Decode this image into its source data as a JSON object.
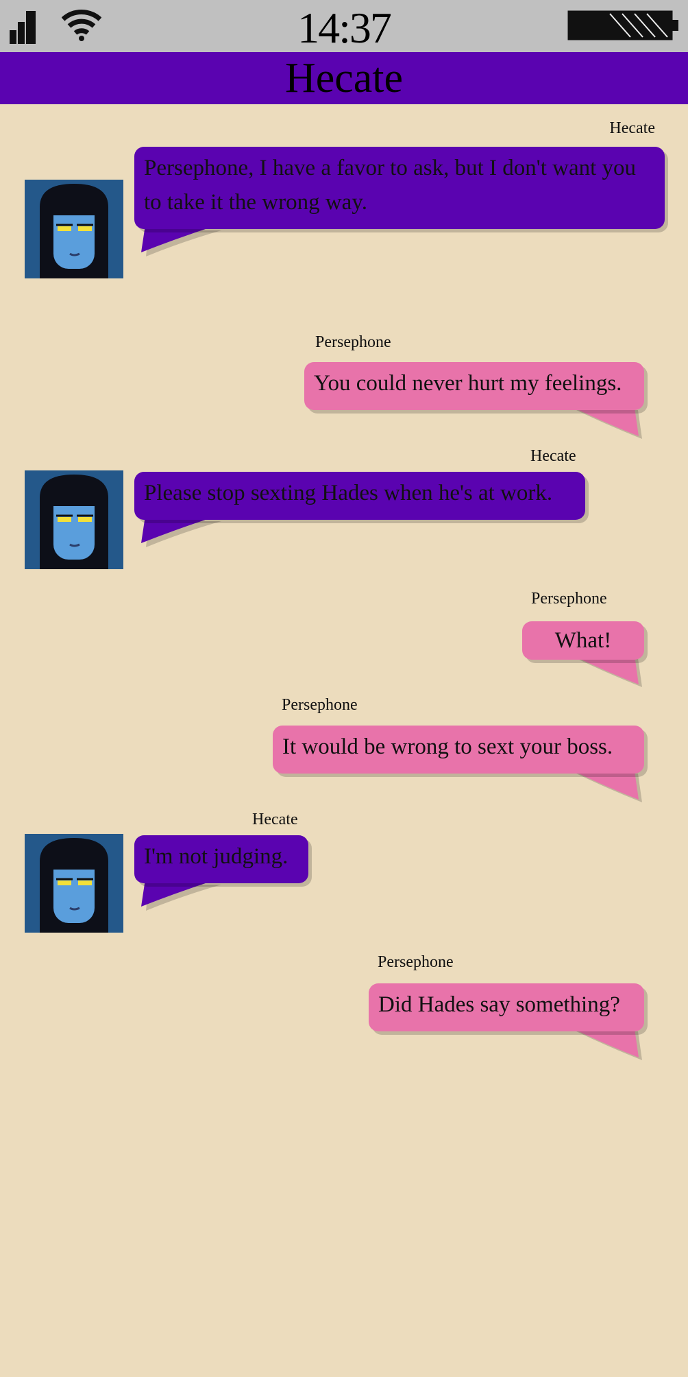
{
  "status_bar": {
    "time": "14:37",
    "signal_icon": "signal-bars-icon",
    "wifi_icon": "wifi-icon",
    "battery_icon": "battery-icon"
  },
  "header": {
    "title": "Hecate"
  },
  "colors": {
    "background": "#ecdcbd",
    "status_bar": "#c0c0c0",
    "header": "#5a03b0",
    "hecate_bubble": "#5a03b0",
    "persephone_bubble": "#e873aa"
  },
  "messages": [
    {
      "sender": "Hecate",
      "text": "Persephone, I have a favor to ask, but I don't want you to take it the wrong way."
    },
    {
      "sender": "Persephone",
      "text": "You could never hurt my feelings."
    },
    {
      "sender": "Hecate",
      "text": "Please stop sexting Hades when he's at work."
    },
    {
      "sender": "Persephone",
      "text": "What!"
    },
    {
      "sender": "Persephone",
      "text": "It would be wrong to sext your boss."
    },
    {
      "sender": "Hecate",
      "text": "I'm not judging."
    },
    {
      "sender": "Persephone",
      "text": "Did Hades say something?"
    }
  ]
}
